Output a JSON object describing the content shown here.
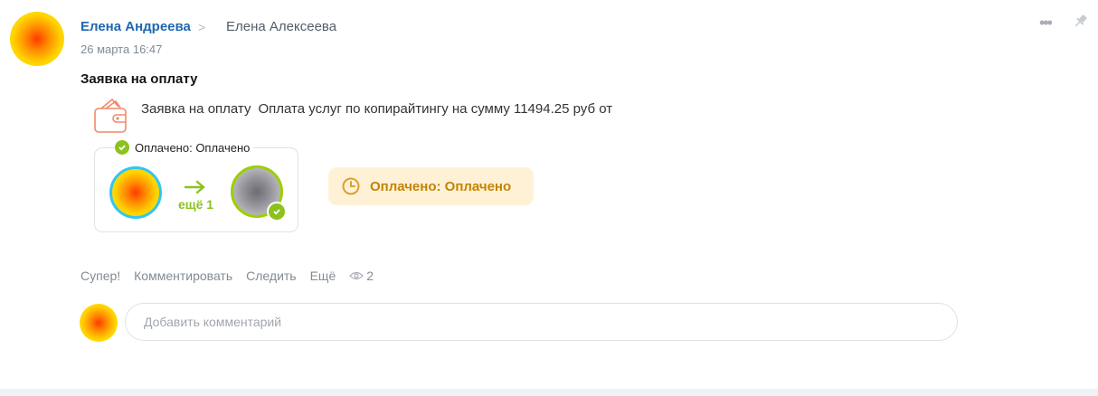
{
  "post": {
    "author": "Елена Андреева",
    "recipient": "Елена Алексеева",
    "date": "26 марта 16:47",
    "title": "Заявка на оплату"
  },
  "request": {
    "type_label": "Заявка на оплату",
    "description": "Оплата услуг по копирайтингу на сумму 11494.25 руб от"
  },
  "status_card": {
    "label": "Оплачено: Оплачено",
    "more": "ещё 1"
  },
  "status_pill": {
    "text": "Оплачено: Оплачено"
  },
  "actions": {
    "like": "Супер!",
    "comment": "Комментировать",
    "follow": "Следить",
    "more": "Ещё",
    "views": "2"
  },
  "comment": {
    "placeholder": "Добавить комментарий"
  },
  "colors": {
    "author_link": "#2067b0",
    "success_green": "#8dc11e",
    "status_pill_bg": "#fff1d6",
    "status_pill_text": "#c48300"
  },
  "icons": [
    "chevron-right-icon",
    "more-dots-icon",
    "pin-icon",
    "wallet-icon",
    "check-icon",
    "arrow-right-icon",
    "clock-icon",
    "eye-icon"
  ]
}
